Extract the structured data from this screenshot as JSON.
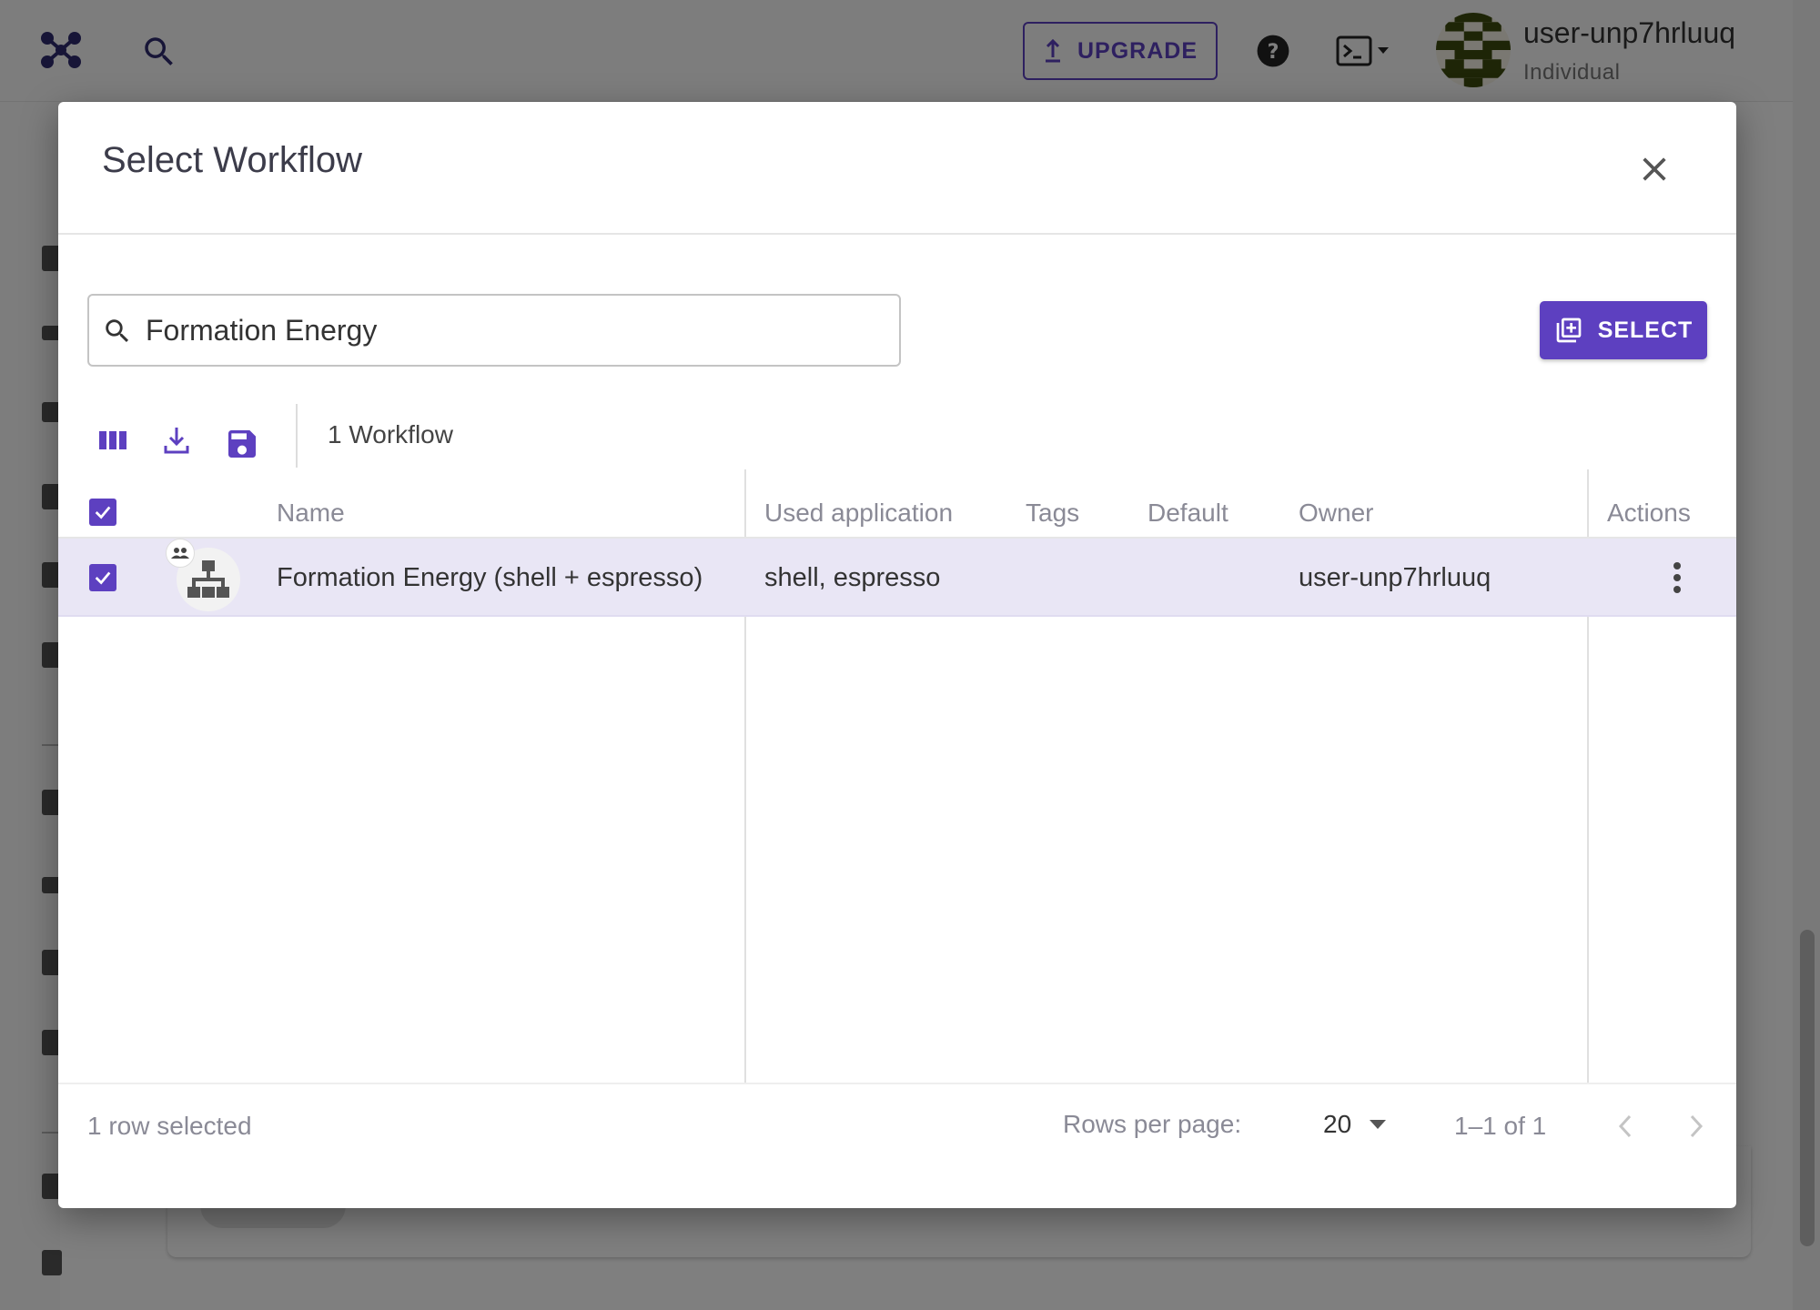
{
  "topbar": {
    "upgrade_label": "UPGRADE",
    "user_name": "user-unp7hrluuq",
    "user_plan": "Individual"
  },
  "dialog": {
    "title": "Select Workflow",
    "search": {
      "value": "Formation Energy",
      "placeholder": ""
    },
    "select_label": "SELECT",
    "workflow_count": "1 Workflow",
    "columns": {
      "name": "Name",
      "used_application": "Used application",
      "tags": "Tags",
      "default": "Default",
      "owner": "Owner",
      "actions": "Actions"
    },
    "rows": [
      {
        "name": "Formation Energy (shell + espresso)",
        "used_application": "shell, espresso",
        "tags": "",
        "default": "",
        "owner": "user-unp7hrluuq",
        "selected": true
      }
    ],
    "footer": {
      "selection_text": "1 row selected",
      "rows_per_page_label": "Rows per page:",
      "rows_per_page_value": "20",
      "range_text": "1–1 of 1"
    }
  },
  "colors": {
    "accent": "#5d40c0",
    "row_selected_bg": "#e9e6f5",
    "muted_text": "#8a8a96"
  },
  "icons": {
    "logo": "molecule-logo-icon",
    "top_search": "search-icon",
    "help": "help-circle-icon",
    "terminal": "terminal-icon",
    "close": "close-icon",
    "search": "search-icon",
    "select": "library-add-icon",
    "columns": "view-column-icon",
    "download": "download-icon",
    "save": "save-icon",
    "workflow": "workflow-tree-icon",
    "shared": "people-icon",
    "actions": "more-vertical-icon",
    "dropdown": "arrow-drop-down-icon",
    "prev": "chevron-left-icon",
    "next": "chevron-right-icon"
  }
}
